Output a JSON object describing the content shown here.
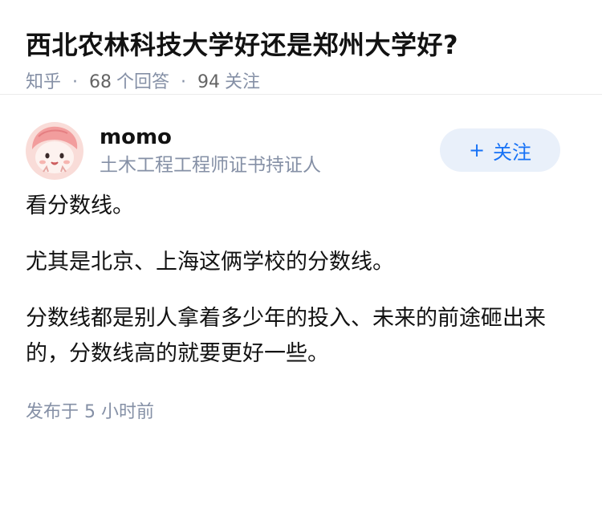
{
  "question": {
    "title": "西北农林科技大学好还是郑州大学好?",
    "source": "知乎",
    "answer_count": "68",
    "answer_label": "个回答",
    "follow_count": "94",
    "follow_label": "关注"
  },
  "answer": {
    "author": {
      "name": "momo",
      "bio": "土木工程工程师证书持证人",
      "avatar_icon": "cartoon-avatar-icon"
    },
    "follow_button": {
      "plus": "+",
      "label": "关注"
    },
    "paragraphs": [
      "看分数线。",
      "尤其是北京、上海这俩学校的分数线。",
      "分数线都是别人拿着多少年的投入、未来的前途砸出来的，分数线高的就要更好一些。"
    ],
    "publish_time": "发布于  5 小时前"
  },
  "colors": {
    "accent": "#1772f6",
    "follow_bg": "#e9f0fa",
    "meta_gray": "#8590a6",
    "text": "#121212"
  }
}
